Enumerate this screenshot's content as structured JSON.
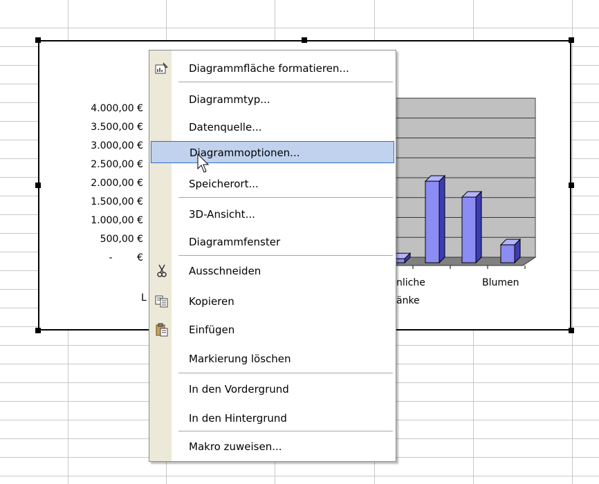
{
  "chart_data": {
    "type": "bar",
    "y_tick_labels": [
      "4.000,00 €",
      "3.500,00 €",
      "3.000,00 €",
      "2.500,00 €",
      "2.000,00 €",
      "1.500,00 €",
      "1.000,00 €",
      "500,00 €",
      "-        €"
    ],
    "x_labels_visible": [
      "L",
      "nliche",
      "Blumen",
      "änke"
    ],
    "values": [
      100,
      2050,
      1650,
      450
    ],
    "ylim": [
      0,
      4000
    ],
    "bar_color": "#8c8cf5",
    "wall_color": "#c0c0c0"
  },
  "context_menu": {
    "items": [
      {
        "label": "Diagrammfläche formatieren...",
        "icon": "format-chart-area-icon"
      },
      {
        "label": "Diagrammtyp..."
      },
      {
        "label": "Datenquelle..."
      },
      {
        "label": "Diagrammoptionen...",
        "highlighted": true
      },
      {
        "label": "Speicherort..."
      },
      {
        "label": "3D-Ansicht..."
      },
      {
        "label": "Diagrammfenster"
      },
      {
        "label": "Ausschneiden",
        "icon": "cut-icon"
      },
      {
        "label": "Kopieren",
        "icon": "copy-icon"
      },
      {
        "label": "Einfügen",
        "icon": "paste-icon"
      },
      {
        "label": "Markierung löschen"
      },
      {
        "label": "In den Vordergrund"
      },
      {
        "label": "In den Hintergrund"
      },
      {
        "label": "Makro zuweisen..."
      }
    ]
  }
}
